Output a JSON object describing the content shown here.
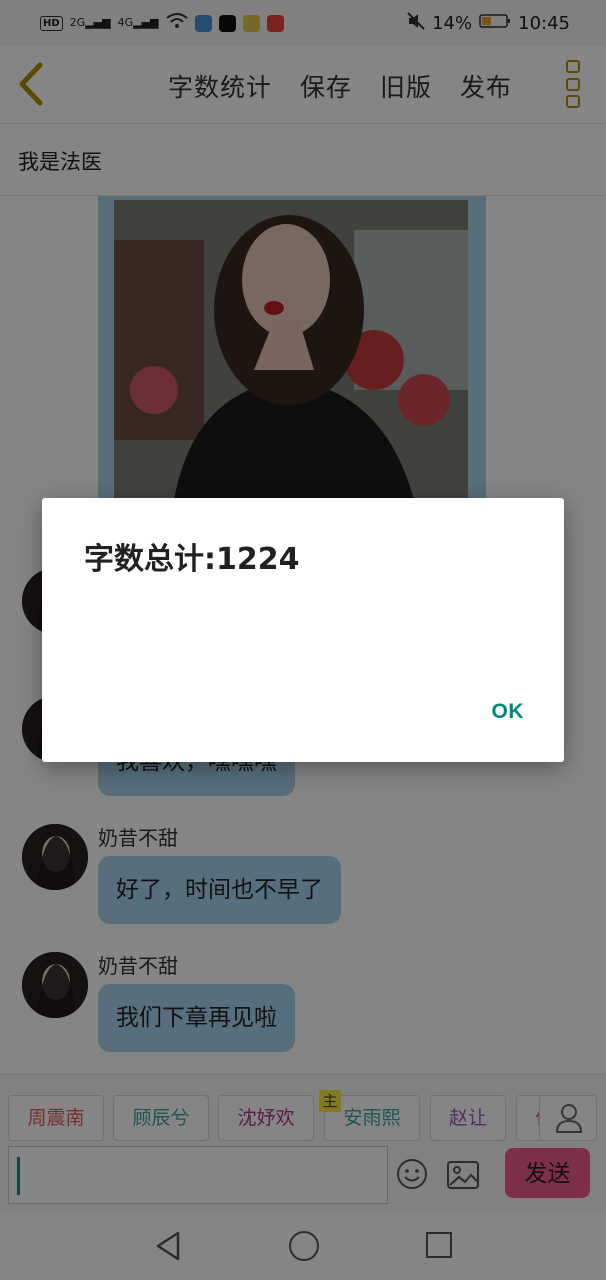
{
  "status_bar": {
    "network_badge": "HD",
    "signal_2g": "2G",
    "signal_4g": "4G",
    "battery_percent": "14%",
    "time": "10:45"
  },
  "toolbar": {
    "word_count_label": "字数统计",
    "save_label": "保存",
    "old_version_label": "旧版",
    "publish_label": "发布"
  },
  "chapter": {
    "title": "我是法医"
  },
  "messages": [
    {
      "sender": "",
      "text": "我喜欢，嘿嘿嘿"
    },
    {
      "sender": "奶昔不甜",
      "text": "好了，时间也不早了"
    },
    {
      "sender": "奶昔不甜",
      "text": "我们下章再见啦"
    }
  ],
  "characters": [
    {
      "name": "周震南",
      "color": "#e05a5a"
    },
    {
      "name": "顾辰兮",
      "color": "#3aa3a0"
    },
    {
      "name": "沈妤欢",
      "color": "#b0348a"
    },
    {
      "name": "安雨熙",
      "color": "#3aa3a0",
      "badge": "主"
    },
    {
      "name": "赵让",
      "color": "#9b59c9"
    },
    {
      "name": "付",
      "color": "#e05a5a"
    }
  ],
  "composer": {
    "send_label": "发送"
  },
  "dialog": {
    "message": "字数总计:1224",
    "ok_label": "OK"
  },
  "colors": {
    "accent_gold": "#b08f00",
    "bubble_blue": "#a8d3ee",
    "send_pink": "#f0588f",
    "ok_teal": "#00897b"
  }
}
